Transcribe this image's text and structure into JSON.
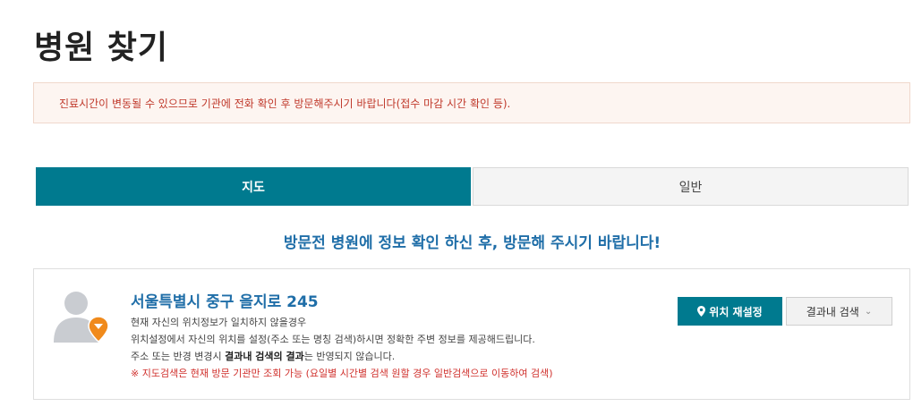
{
  "page": {
    "title": "병원 찾기"
  },
  "notice": {
    "text": "진료시간이 변동될 수 있으므로 기관에 전화 확인 후 방문해주시기 바랍니다(접수 마감 시간 확인 등)."
  },
  "tabs": [
    {
      "label": "지도",
      "active": true
    },
    {
      "label": "일반",
      "active": false
    }
  ],
  "headline": "방문전 병원에 정보 확인 하신 후, 방문해 주시기 바랍니다!",
  "location": {
    "address": "서울특별시 중구 을지로 245",
    "lines": {
      "l1": "현재 자신의 위치정보가 일치하지 않을경우",
      "l2": "위치설정에서 자신의 위치를 설정(주소 또는 명칭 검색)하시면 정확한 주변 정보를 제공해드립니다.",
      "l3_pre": "주소 또는 반경 변경시 ",
      "l3_bold": "결과내 검색의 결과",
      "l3_post": "는 반영되지 않습니다.",
      "l4": "※ 지도검색은 현재 방문 기관만 조회 가능 (요일별 시간별 검색 원할 경우 일반검색으로 이동하여 검색)"
    },
    "relocate_label": "위치 재설정",
    "filter_label": "결과내 검색"
  },
  "icons": {
    "avatar": "user-silhouette-icon",
    "pin_badge": "location-pin-icon",
    "relocate": "map-marker-icon",
    "filter": "chevron-down-icon"
  },
  "colors": {
    "accent": "#007a8f",
    "headline": "#1f6ea8",
    "warning": "#d0312d",
    "pin": "#f08a1c"
  }
}
